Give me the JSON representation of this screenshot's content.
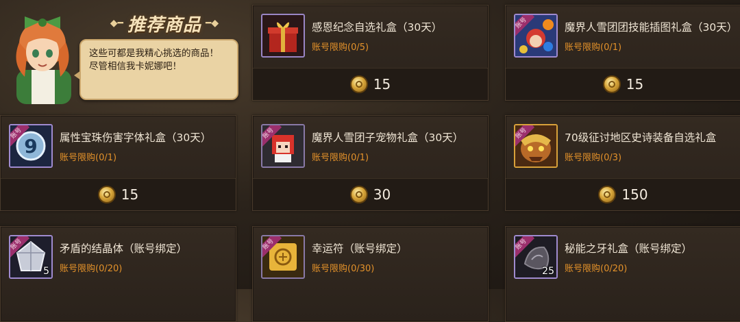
{
  "header": {
    "title": "推荐商品",
    "npc_lines": [
      "这些可都是我精心挑选的商品！",
      "尽管相信我卡妮娜吧！"
    ]
  },
  "labels": {
    "badge": "账号"
  },
  "items": [
    {
      "name": "感恩纪念自选礼盒（30天）",
      "limit": "账号限购(0/5)",
      "price": "15",
      "badge": false,
      "qty": "",
      "icon": "gift-box-icon"
    },
    {
      "name": "魔界人雪团团技能插图礼盒（30天）",
      "limit": "账号限购(0/1)",
      "price": "15",
      "badge": true,
      "qty": "",
      "icon": "character-orbs-icon"
    },
    {
      "name": "属性宝珠伤害字体礼盒（30天）",
      "limit": "账号限购(0/1)",
      "price": "15",
      "badge": true,
      "qty": "",
      "icon": "number-nine-icon"
    },
    {
      "name": "魔界人雪团子宠物礼盒（30天）",
      "limit": "账号限购(0/1)",
      "price": "30",
      "badge": true,
      "qty": "",
      "icon": "pixel-girl-icon"
    },
    {
      "name": "70级征讨地区史诗装备自选礼盒",
      "limit": "账号限购(0/3)",
      "price": "150",
      "badge": true,
      "qty": "",
      "icon": "monster-icon"
    },
    {
      "name": "矛盾的结晶体（账号绑定）",
      "limit": "账号限购(0/20)",
      "price": "",
      "badge": true,
      "qty": "5",
      "icon": "crystal-icon"
    },
    {
      "name": "幸运符（账号绑定）",
      "limit": "账号限购(0/30)",
      "price": "",
      "badge": true,
      "qty": "",
      "icon": "scroll-icon"
    },
    {
      "name": "秘能之牙礼盒（账号绑定）",
      "limit": "账号限购(0/20)",
      "price": "",
      "badge": true,
      "qty": "25",
      "icon": "fang-stone-icon"
    }
  ]
}
